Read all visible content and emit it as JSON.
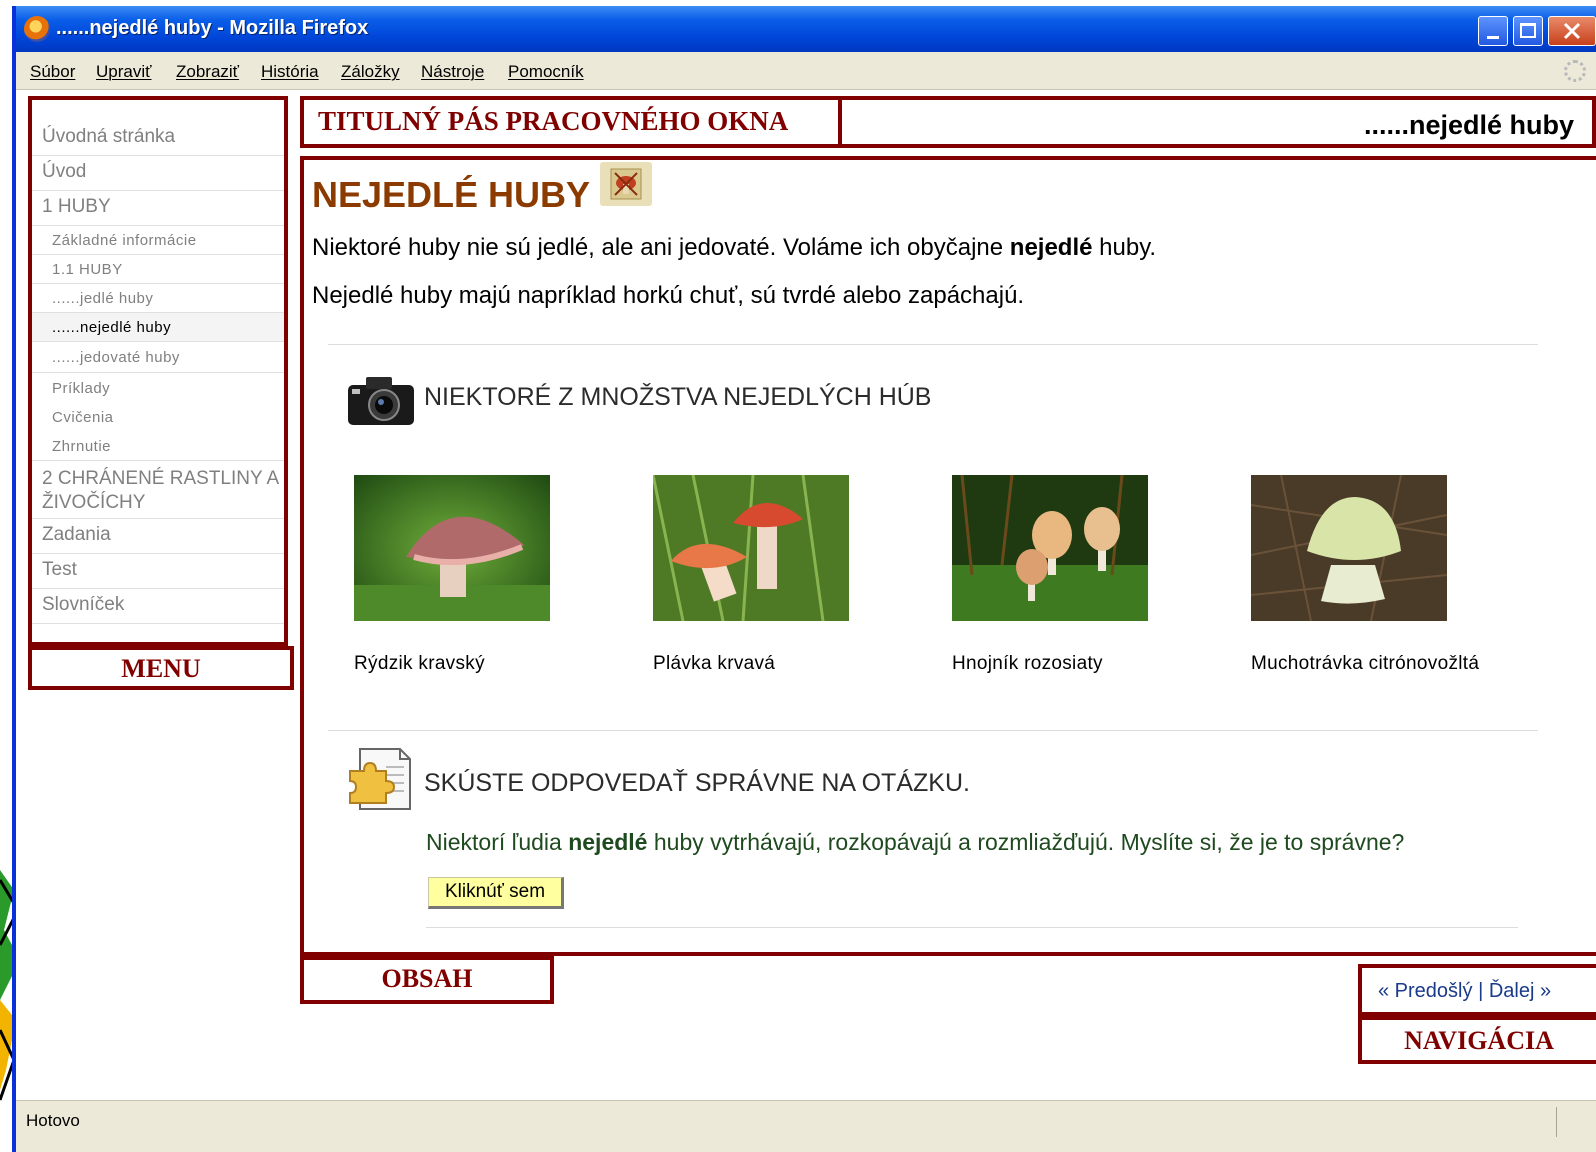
{
  "window": {
    "title": "......nejedlé huby - Mozilla Firefox"
  },
  "menubar": {
    "items": [
      "Súbor",
      "Upraviť",
      "Zobraziť",
      "História",
      "Záložky",
      "Nástroje",
      "Pomocník"
    ]
  },
  "sidebar": {
    "items": [
      {
        "label": "Úvodná stránka"
      },
      {
        "label": "Úvod"
      },
      {
        "label": "1 HUBY"
      },
      {
        "label": "Základné informácie"
      },
      {
        "label": "1.1 HUBY"
      },
      {
        "label": "......jedlé huby"
      },
      {
        "label": "......nejedlé huby"
      },
      {
        "label": "......jedovaté huby"
      },
      {
        "label": "Príklady"
      },
      {
        "label": "Cvičenia"
      },
      {
        "label": "Zhrnutie"
      },
      {
        "label": "2 CHRÁNENÉ RASTLINY A ŽIVOČÍCHY"
      },
      {
        "label": "Zadania"
      },
      {
        "label": "Test"
      },
      {
        "label": "Slovníček"
      }
    ],
    "label": "MENU"
  },
  "title_strip": {
    "label": "TITULNÝ PÁS PRACOVNÉHO OKNA",
    "page_title": "......nejedlé huby"
  },
  "content": {
    "title": "NEJEDLÉ HUBY",
    "intro_1_before": "Niektoré huby nie sú jedlé, ale ani jedovaté. Voláme ich obyčajne ",
    "intro_1_bold": "nejedlé",
    "intro_1_after": " huby.",
    "intro_2": "Nejedlé huby majú napríklad horkú chuť, sú tvrdé alebo zapáchajú.",
    "gallery_heading": "NIEKTORÉ Z MNOŽSTVA NEJEDLÝCH HÚB",
    "mushrooms": [
      {
        "name": "Rýdzik kravský"
      },
      {
        "name": "Plávka krvavá"
      },
      {
        "name": "Hnojník rozosiaty"
      },
      {
        "name": "Muchotrávka citrónovožltá"
      }
    ],
    "question_heading": "SKÚSTE ODPOVEDAŤ SPRÁVNE NA OTÁZKU.",
    "question_before": "Niektorí ľudia ",
    "question_bold": "nejedlé",
    "question_after": " huby vytrhávajú, rozkopávajú a rozmliažďujú. Myslíte si, že je to správne?",
    "answer_button": "Kliknúť sem",
    "label": "OBSAH"
  },
  "navigation": {
    "prev": "« Predošlý",
    "separator": "|",
    "next": "Ďalej »",
    "label": "NAVIGÁCIA"
  },
  "status": {
    "text": "Hotovo"
  },
  "colors": {
    "frame": "#800000",
    "title_brown": "#8b3a00",
    "question_green": "#1f4a1f",
    "button_yellow": "#ffffa0"
  }
}
